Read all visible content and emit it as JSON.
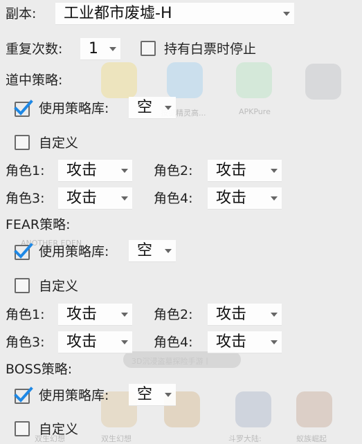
{
  "dungeon": {
    "label": "副本:",
    "value": "工业都市废墟-H"
  },
  "repeat": {
    "label": "重复次数:",
    "value": "1",
    "stop_label": "持有白票时停止"
  },
  "sections": [
    {
      "title": "道中策略:",
      "use_lib_label": "使用策略库:",
      "use_lib_checked": true,
      "lib_value": "空",
      "custom_label": "自定义",
      "custom_checked": false,
      "roles": [
        {
          "label": "角色1:",
          "value": "攻击"
        },
        {
          "label": "角色2:",
          "value": "攻击"
        },
        {
          "label": "角色3:",
          "value": "攻击"
        },
        {
          "label": "角色4:",
          "value": "攻击"
        }
      ]
    },
    {
      "title": "FEAR策略:",
      "use_lib_label": "使用策略库:",
      "use_lib_checked": true,
      "lib_value": "空",
      "custom_label": "自定义",
      "custom_checked": false,
      "roles": [
        {
          "label": "角色1:",
          "value": "攻击"
        },
        {
          "label": "角色2:",
          "value": "攻击"
        },
        {
          "label": "角色3:",
          "value": "攻击"
        },
        {
          "label": "角色4:",
          "value": "攻击"
        }
      ]
    },
    {
      "title": "BOSS策略:",
      "use_lib_label": "使用策略库:",
      "use_lib_checked": true,
      "lib_value": "空",
      "custom_label": "自定义",
      "custom_checked": false
    }
  ],
  "background": {
    "app_labels": [
      "按键精灵高...",
      "APKPure",
      "ANOTHER EDEN",
      "3D沉浸盗墓探险手游丨",
      "双生幻想",
      "双生幻想",
      "斗罗大陆:",
      "蚁族崛起"
    ],
    "accent": "#1e88e5"
  }
}
